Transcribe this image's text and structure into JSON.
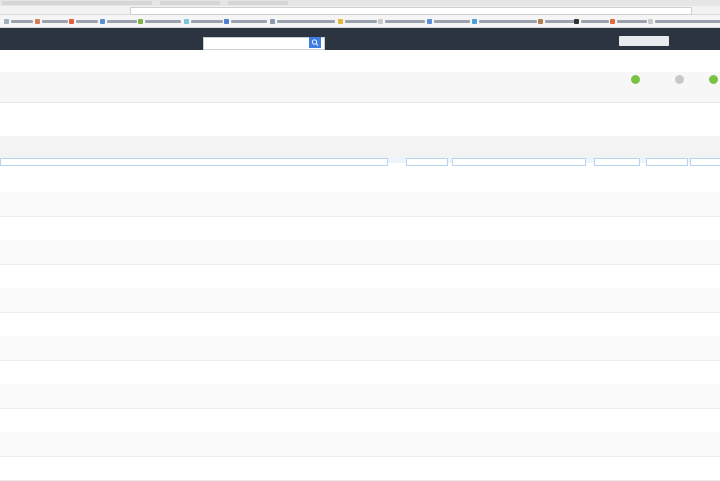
{
  "app": {
    "title": ""
  },
  "search": {
    "placeholder": "",
    "button_label": ""
  },
  "user": {
    "label": "",
    "menu": ""
  },
  "toolbar": {
    "tools": [
      {
        "label": ""
      },
      {
        "label": ""
      },
      {
        "label": ""
      }
    ]
  },
  "breadcrumb": "",
  "table": {
    "columns": [
      "",
      "",
      "",
      "",
      "",
      ""
    ],
    "rows": [
      [
        "",
        "",
        "",
        "",
        ""
      ],
      [
        "",
        "",
        "",
        "",
        ""
      ],
      [
        "",
        "",
        "",
        "",
        ""
      ],
      [
        "",
        "",
        "",
        "",
        ""
      ],
      [
        "",
        "",
        "",
        "",
        ""
      ],
      [
        "",
        "",
        "",
        "",
        ""
      ],
      [
        "",
        "",
        "",
        "",
        ""
      ],
      [
        "",
        "",
        "",
        "",
        ""
      ],
      [
        "",
        "",
        "",
        "",
        ""
      ],
      [
        "",
        "",
        "",
        "",
        ""
      ],
      [
        "",
        "",
        "",
        "",
        ""
      ],
      [
        "",
        "",
        "",
        "",
        ""
      ],
      [
        "",
        "",
        "",
        "",
        ""
      ]
    ]
  },
  "colors": {
    "appbar": "#2b3440",
    "accent_blue": "#3d7ee0",
    "tool_green": "#7cc242",
    "tool_grey": "#c8c8c8"
  },
  "icons": [
    "search-icon",
    "add-icon",
    "refresh-icon",
    "export-icon"
  ]
}
